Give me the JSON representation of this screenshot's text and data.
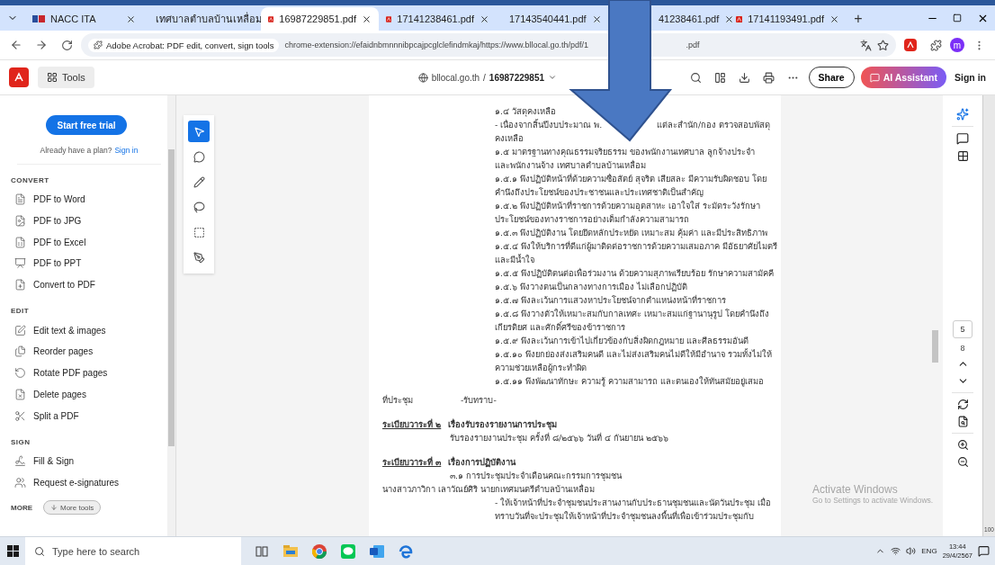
{
  "browser": {
    "tabs": [
      {
        "kind": "site",
        "title": "NACC ITA",
        "selected": false
      },
      {
        "kind": "globe",
        "title": "เทศบาลตำบลบ้านเหลื่อม",
        "selected": false
      },
      {
        "kind": "pdf",
        "title": "16987229851.pdf",
        "selected": true
      },
      {
        "kind": "pdf",
        "title": "17141238461.pdf",
        "selected": false
      },
      {
        "kind": "pdf",
        "title": "17143540441.pdf",
        "selected": false
      },
      {
        "kind": "plain",
        "title": "41238461.pdf",
        "selected": false
      },
      {
        "kind": "pdf",
        "title": "17141193491.pdf",
        "selected": false
      }
    ],
    "new_tab": "+",
    "address": {
      "extension": "Adobe Acrobat: PDF edit, convert, sign tools",
      "url_start": "chrome-extension://efaidnbmnnnibpcajpcglclefindmkaj/https://www.bllocal.go.th/pdf/1",
      "url_end": ".pdf",
      "profile": "m"
    }
  },
  "acrobat": {
    "tools": "Tools",
    "domain": "bllocal.go.th",
    "separator": "/",
    "file": "16987229851",
    "share": "Share",
    "ai": "AI Assistant",
    "sign_in": "Sign in"
  },
  "sidebar": {
    "trial": "Start free trial",
    "plan": "Already have a plan?",
    "plan_link": "Sign in",
    "sections": [
      {
        "title": "CONVERT",
        "items": [
          {
            "kind": "word",
            "label": "PDF to Word"
          },
          {
            "kind": "jpg",
            "label": "PDF to JPG"
          },
          {
            "kind": "excel",
            "label": "PDF to Excel"
          },
          {
            "kind": "ppt",
            "label": "PDF to PPT"
          },
          {
            "kind": "convert",
            "label": "Convert to PDF"
          }
        ]
      },
      {
        "title": "EDIT",
        "items": [
          {
            "kind": "edit",
            "label": "Edit text & images"
          },
          {
            "kind": "reorder",
            "label": "Reorder pages"
          },
          {
            "kind": "rotate",
            "label": "Rotate PDF pages"
          },
          {
            "kind": "delete",
            "label": "Delete pages"
          },
          {
            "kind": "split",
            "label": "Split a PDF"
          }
        ]
      },
      {
        "title": "SIGN",
        "items": [
          {
            "kind": "sign",
            "label": "Fill & Sign"
          },
          {
            "kind": "request",
            "label": "Request e-signatures"
          }
        ]
      }
    ],
    "more": {
      "title": "MORE",
      "button": "More tools"
    }
  },
  "tool_rail": [
    {
      "kind": "select",
      "selected": true
    },
    {
      "kind": "comment",
      "selected": false
    },
    {
      "kind": "draw",
      "selected": false
    },
    {
      "kind": "lasso",
      "selected": false
    },
    {
      "kind": "text",
      "selected": false
    },
    {
      "kind": "sign",
      "selected": false
    }
  ],
  "document": [
    {
      "kind": "body",
      "text": "๑.๔ วัสดุคงเหลือ"
    },
    {
      "kind": "split",
      "left": "- เนื่องจากสิ้นปีงบประมาณ พ.",
      "right": "แต่ละสำนัก/กอง ตรวจสอบพัสดุ"
    },
    {
      "kind": "body",
      "text": "คงเหลือ"
    },
    {
      "kind": "body",
      "text": "๑.๕ มาตรฐานทางคุณธรรมจริยธรรม ของพนักงานเทศบาล ลูกจ้างประจำ"
    },
    {
      "kind": "body",
      "text": "และพนักงานจ้าง เทศบาลตำบลบ้านเหลื่อม"
    },
    {
      "kind": "body",
      "text": "๑.๕.๑ พึงปฏิบัติหน้าที่ด้วยความซื่อสัตย์ สุจริต เสียสละ มีความรับผิดชอบ โดย"
    },
    {
      "kind": "body",
      "text": "คำนึงถึงประโยชน์ของประชาชนและประเทศชาติเป็นสำคัญ"
    },
    {
      "kind": "body",
      "text": "๑.๕.๒ พึงปฏิบัติหน้าที่ราชการด้วยความอุตสาหะ เอาใจใส่ ระมัดระวังรักษา"
    },
    {
      "kind": "body",
      "text": "ประโยชน์ของทางราชการอย่างเต็มกำลังความสามารถ"
    },
    {
      "kind": "body",
      "text": "๑.๕.๓ พึงปฏิบัติงาน โดยยึดหลักประหยัด เหมาะสม คุ้มค่า และมีประสิทธิภาพ"
    },
    {
      "kind": "body",
      "text": "๑.๕.๔ พึงให้บริการที่ดีแก่ผู้มาติดต่อราชการด้วยความเสมอภาค มีอัธยาศัยไมตรี"
    },
    {
      "kind": "body",
      "text": "และมีน้ำใจ"
    },
    {
      "kind": "body",
      "text": "๑.๕.๕ พึงปฏิบัติตนต่อเพื่อร่วมงาน ด้วยความสุภาพเรียบร้อย รักษาความสามัคคี"
    },
    {
      "kind": "body",
      "text": "๑.๕.๖ พึงวางตนเป็นกลางทางการเมือง ไม่เลือกปฏิบัติ"
    },
    {
      "kind": "body",
      "text": "๑.๕.๗ พึงละเว้นการแสวงหาประโยชน์จากตำแหน่งหน้าที่ราชการ"
    },
    {
      "kind": "body",
      "text": "๑.๕.๘ พึงวางตัวให้เหมาะสมกับกาลเทศะ เหมาะสมแก่ฐานานุรูป โดยคำนึงถึง"
    },
    {
      "kind": "body",
      "text": "เกียรติยศ และศักดิ์ศรีของข้าราชการ"
    },
    {
      "kind": "body",
      "text": "๑.๕.๙ พึงละเว้นการเข้าไปเกี่ยวข้องกับสิ่งผิดกฎหมาย และศีลธรรมอันดี"
    },
    {
      "kind": "body",
      "text": "๑.๕.๑๐ พึงยกย่องส่งเสริมคนดี และไม่ส่งเสริมคนไม่ดีให้มีอำนาจ รวมทั้งไม่ให้"
    },
    {
      "kind": "body",
      "text": "ความช่วยเหลือผู้กระทำผิด"
    },
    {
      "kind": "body",
      "text": "๑.๕.๑๑ พึงพัฒนาทักษะ ความรู้ ความสามารถ และตนเองให้ทันสมัยอยู่เสมอ"
    },
    {
      "kind": "pair",
      "label": "ที่ประชุม",
      "text": "-รับทราบ-"
    },
    {
      "kind": "agenda",
      "label": "ระเบียบวาระที่ ๒",
      "text": "เรื่องรับรองรายงานการประชุม"
    },
    {
      "kind": "sub",
      "text": "รับรองรายงานประชุม ครั้งที่ ๘/๒๕๖๖ วันที่ ๔ กันยายน ๒๕๖๖"
    },
    {
      "kind": "agenda",
      "label": "ระเบียบวาระที่ ๓",
      "text": "เรื่องการปฏิบัติงาน"
    },
    {
      "kind": "sub",
      "text": "๓.๑ การประชุมประจำเดือนคณะกรรมการชุมชน"
    },
    {
      "kind": "full",
      "text": "นางสาวภาวิกา เลาวัณย์ศิริ นายกเทศมนตรีตำบลบ้านเหลื่อม"
    },
    {
      "kind": "body",
      "text": "- ให้เจ้าหน้าที่ประจำชุมชนประสานงานกับประธานชุมชนและนัดวันประชุม เมื่อ"
    },
    {
      "kind": "body",
      "text": "ทราบวันที่จะประชุมให้เจ้าหน้าที่ประจำชุมชนลงพื้นที่เพื่อเข้าร่วมประชุมกับ"
    }
  ],
  "page_nav": {
    "current": "5",
    "total": "8"
  },
  "activation": {
    "title": "Activate Windows",
    "subtitle": "Go to Settings to activate Windows."
  },
  "side_strip": "100",
  "taskbar": {
    "search": "Type here to search",
    "language": "ENG",
    "time": "13:44",
    "date": "29/4/2567"
  }
}
